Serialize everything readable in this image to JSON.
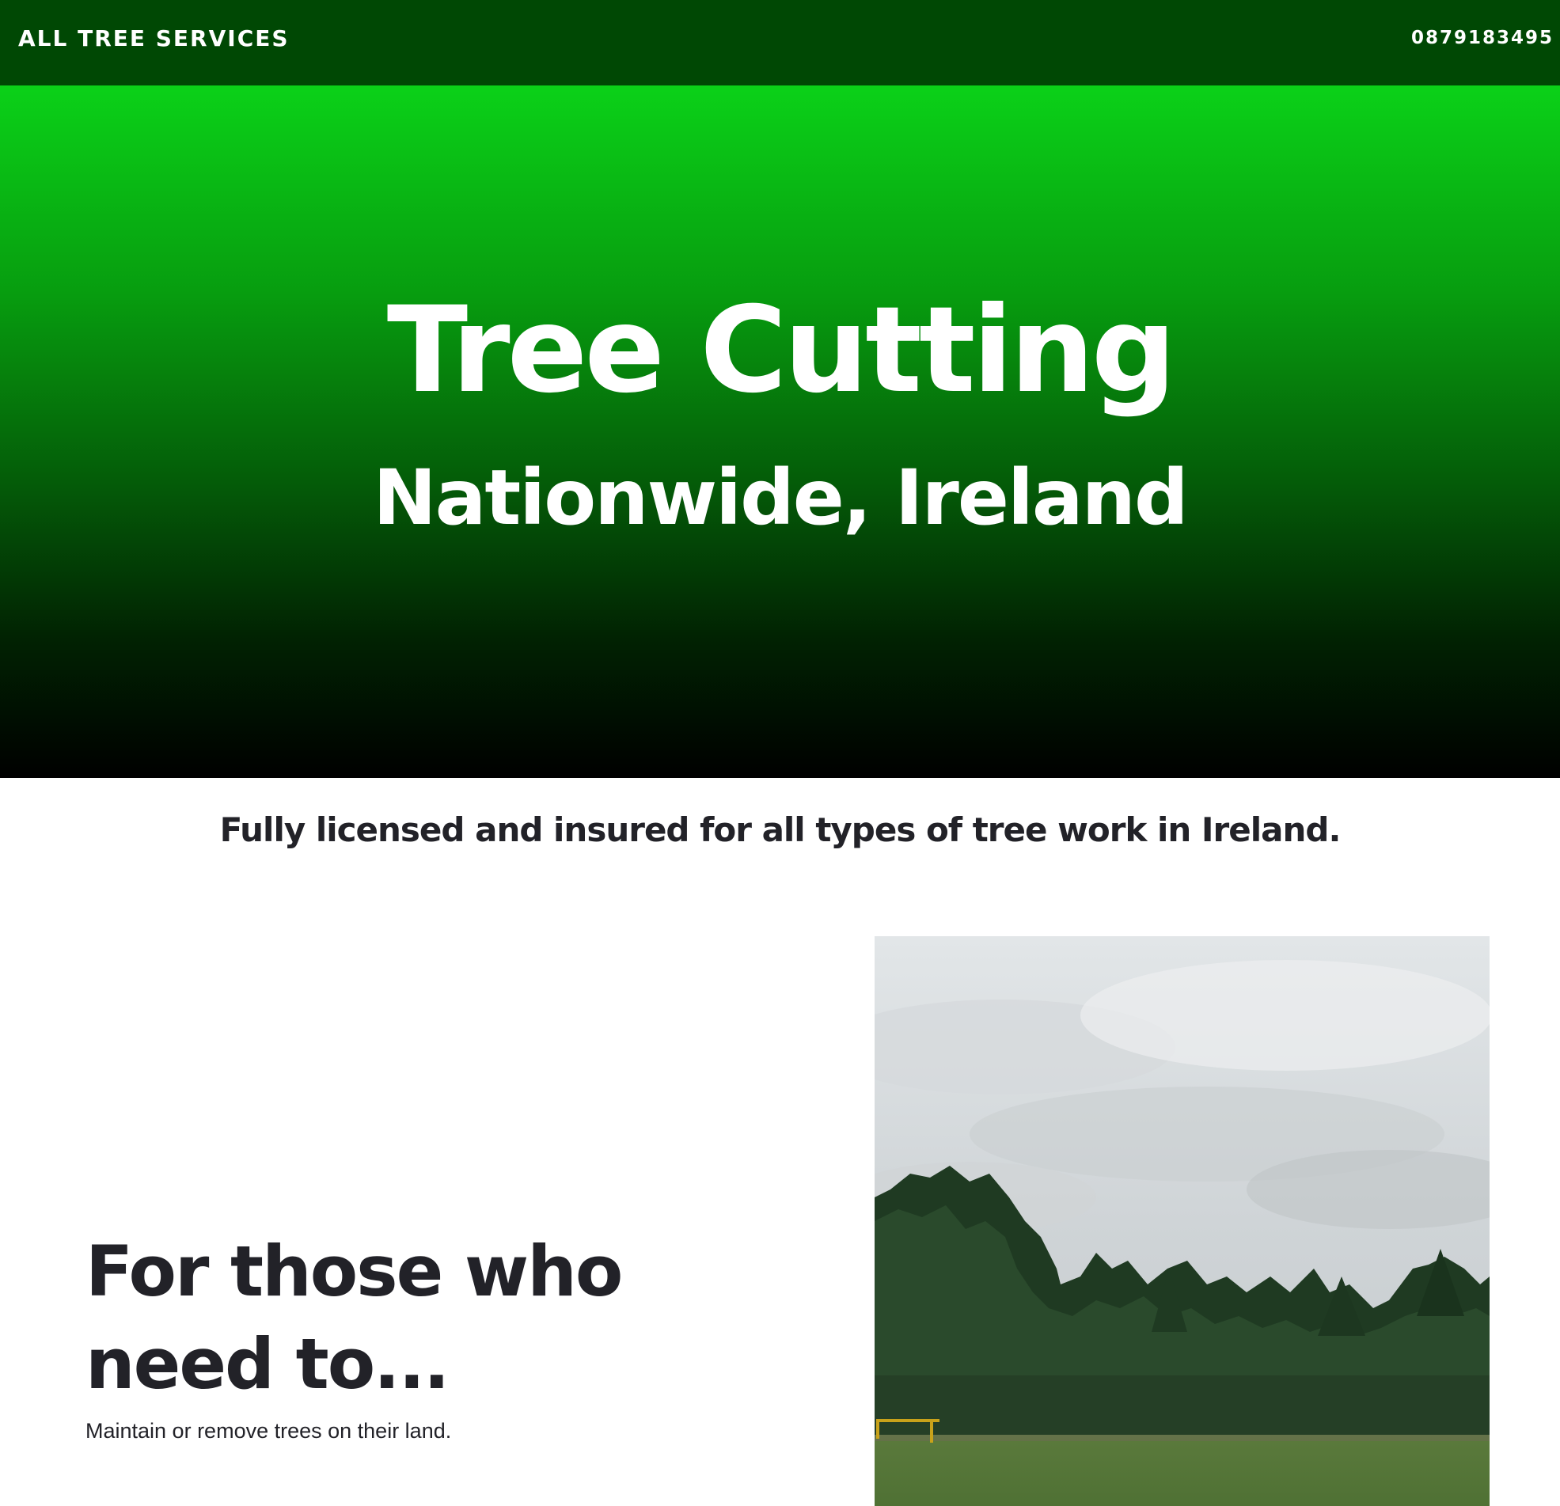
{
  "header": {
    "brand": "ALL TREE SERVICES",
    "phone": "0879183495"
  },
  "hero": {
    "title": "Tree Cutting",
    "subtitle": "Nationwide, Ireland"
  },
  "tagline": "Fully licensed and insured for all types of tree work in Ireland.",
  "feature": {
    "heading_line1": "For those who",
    "heading_line2": "need to...",
    "text": "Maintain or remove trees on their land."
  },
  "colors": {
    "header_bg": "#004804",
    "hero_top": "#0bd118",
    "hero_bottom": "#000000",
    "text_dark": "#222228"
  }
}
